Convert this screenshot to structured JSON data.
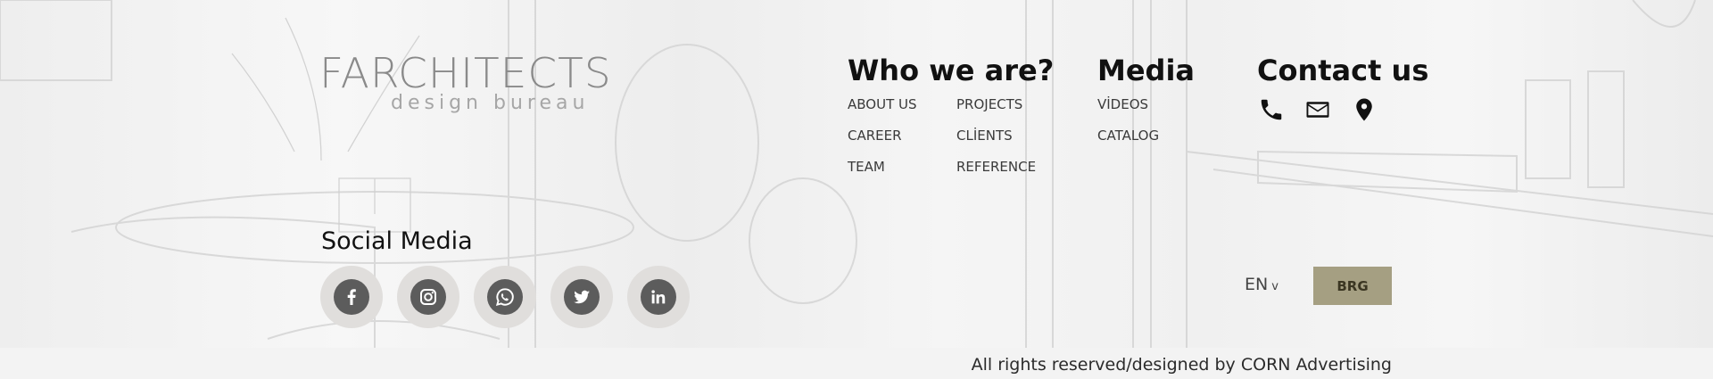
{
  "logo": {
    "main": "FARCHITECTS",
    "sub": "design bureau"
  },
  "who_we_are": {
    "title": "Who we are?",
    "links_col1": [
      "ABOUT US",
      "CAREER",
      "TEAM"
    ],
    "links_col2": [
      "PROJECTS",
      "CLİENTS",
      "REFERENCE"
    ]
  },
  "media": {
    "title": "Media",
    "links": [
      "VİDEOS",
      "CATALOG"
    ]
  },
  "contact": {
    "title": "Contact us",
    "icons": [
      "phone-icon",
      "mail-icon",
      "location-pin-icon"
    ]
  },
  "social": {
    "title": "Social Media",
    "icons": [
      "facebook-icon",
      "instagram-icon",
      "whatsapp-icon",
      "twitter-icon",
      "linkedin-icon"
    ]
  },
  "language": {
    "current": "EN",
    "chevron": "v"
  },
  "brg_button": "BRG",
  "copyright": "All rights reserved/designed by CORN Advertising",
  "colors": {
    "accent": "#a59f82",
    "icon_dark": "#5c5c5c",
    "social_bg": "#e0dedc"
  }
}
